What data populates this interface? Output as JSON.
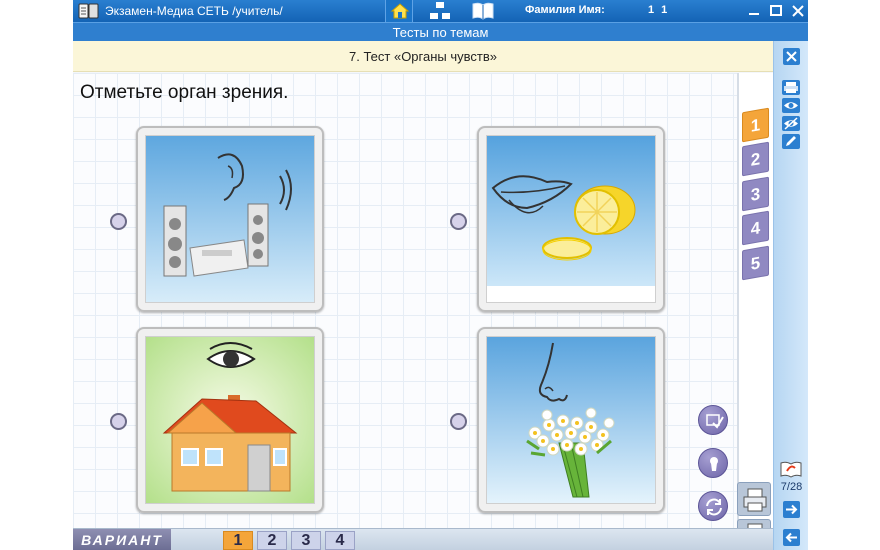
{
  "window": {
    "title": "Экзамен-Медиа СЕТЬ /учитель/",
    "student_label": "Фамилия Имя:",
    "student_name": "1 1"
  },
  "header": {
    "section_title": "Тесты по темам"
  },
  "test": {
    "title": "7. Тест «Органы чувств»",
    "question": "Отметьте орган зрения."
  },
  "question_tabs": [
    "1",
    "2",
    "3",
    "4",
    "5"
  ],
  "active_question": 0,
  "options": [
    {
      "icon": "ear-speakers-icon"
    },
    {
      "icon": "mouth-lemon-icon"
    },
    {
      "icon": "eye-house-icon"
    },
    {
      "icon": "nose-flowers-icon"
    }
  ],
  "sidebar": {
    "counter": "7/28"
  },
  "variant": {
    "label": "ВАРИАНТ",
    "items": [
      "1",
      "2",
      "3",
      "4"
    ],
    "active": 0
  },
  "colors": {
    "titlebar": "#1463b5",
    "accent_orange": "#f4a53a",
    "tab_purple": "#9089c2",
    "test_bar": "#fbf6d8"
  }
}
